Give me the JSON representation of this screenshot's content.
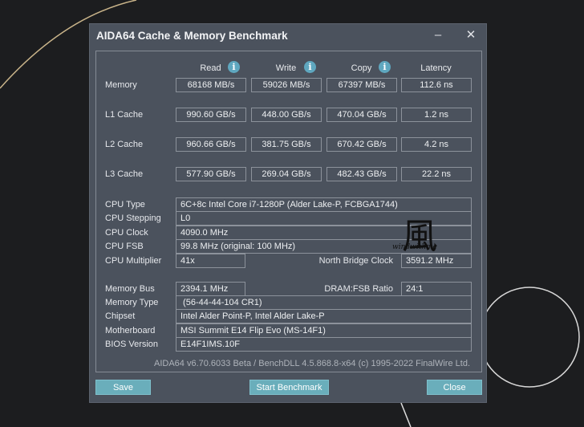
{
  "window": {
    "title": "AIDA64 Cache & Memory Benchmark",
    "minimize_icon": "minimize-icon",
    "close_icon": "close-icon"
  },
  "columns": [
    "Read",
    "Write",
    "Copy",
    "Latency"
  ],
  "bench_rows": [
    {
      "label": "Memory",
      "values": [
        "68168 MB/s",
        "59026 MB/s",
        "67397 MB/s",
        "112.6 ns"
      ]
    },
    {
      "label": "L1 Cache",
      "values": [
        "990.60 GB/s",
        "448.00 GB/s",
        "470.04 GB/s",
        "1.2 ns"
      ]
    },
    {
      "label": "L2 Cache",
      "values": [
        "960.66 GB/s",
        "381.75 GB/s",
        "670.42 GB/s",
        "4.2 ns"
      ]
    },
    {
      "label": "L3 Cache",
      "values": [
        "577.90 GB/s",
        "269.04 GB/s",
        "482.43 GB/s",
        "22.2 ns"
      ]
    }
  ],
  "cpu": {
    "type_label": "CPU Type",
    "type": "6C+8c Intel Core i7-1280P  (Alder Lake-P, FCBGA1744)",
    "stepping_label": "CPU Stepping",
    "stepping": "L0",
    "clock_label": "CPU Clock",
    "clock": "4090.0 MHz",
    "fsb_label": "CPU FSB",
    "fsb": "99.8 MHz  (original: 100 MHz)",
    "mult_label": "CPU Multiplier",
    "mult": "41x",
    "nb_label": "North Bridge Clock",
    "nb": "3591.2 MHz"
  },
  "mem": {
    "bus_label": "Memory Bus",
    "bus": "2394.1 MHz",
    "ratio_label": "DRAM:FSB Ratio",
    "ratio": "24:1",
    "type_label": "Memory Type",
    "type": " (56-44-44-104 CR1)",
    "chipset_label": "Chipset",
    "chipset": "Intel Alder Point-P, Intel Alder Lake-P",
    "mb_label": "Motherboard",
    "mb": "MSI Summit E14 Flip Evo (MS-14F1)",
    "bios_label": "BIOS Version",
    "bios": "E14F1IMS.10F"
  },
  "footer": "AIDA64 v6.70.6033 Beta / BenchDLL 4.5.868.8-x64  (c) 1995-2022 FinalWire Ltd.",
  "buttons": {
    "save": "Save",
    "start": "Start Benchmark",
    "close": "Close"
  },
  "watermark": {
    "glyph": "風",
    "text": "windwithme"
  }
}
